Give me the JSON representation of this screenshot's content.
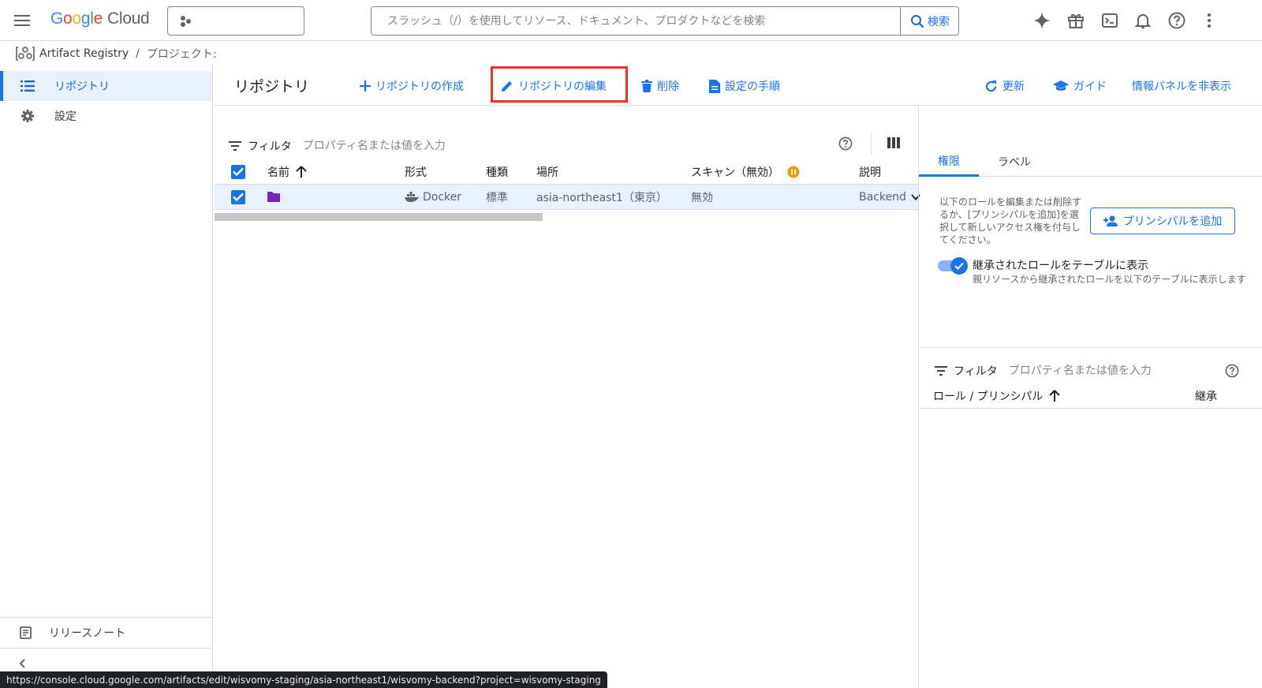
{
  "topbar": {
    "logo_letters": [
      "G",
      "o",
      "o",
      "g",
      "l",
      "e"
    ],
    "logo_product": "Cloud",
    "search_placeholder": "スラッシュ（/）を使用してリソース、ドキュメント、プロダクトなどを検索",
    "search_button": "検索"
  },
  "breadcrumb": {
    "service": "Artifact Registry",
    "separator": "/",
    "project_label": "プロジェクト:"
  },
  "sidebar": {
    "items": [
      {
        "label": "リポジトリ",
        "icon": "list-icon",
        "active": true
      },
      {
        "label": "設定",
        "icon": "gear-icon",
        "active": false
      }
    ],
    "release_notes": "リリースノート"
  },
  "toolbar": {
    "title": "リポジトリ",
    "create": "リポジトリの作成",
    "edit": "リポジトリの編集",
    "delete": "削除",
    "setup": "設定の手順",
    "refresh": "更新",
    "guide": "ガイド",
    "hide_panel": "情報パネルを非表示"
  },
  "filter": {
    "label": "フィルタ",
    "placeholder": "プロパティ名または値を入力"
  },
  "table": {
    "columns": [
      "名前",
      "形式",
      "種類",
      "場所",
      "スキャン（無効）",
      "説明"
    ],
    "rows": [
      {
        "name": "",
        "format": "Docker",
        "mode": "標準",
        "location": "asia-northeast1（東京）",
        "scan": "無効",
        "description": "Backend"
      }
    ]
  },
  "right_panel": {
    "tabs": [
      "権限",
      "ラベル"
    ],
    "description": "以下のロールを編集または削除するか、[プリンシパルを追加]を選択して新しいアクセス権を付与してください。",
    "add_principal": "プリンシパルを追加",
    "toggle_label": "継承されたロールをテーブルに表示",
    "toggle_sub": "親リソースから継承されたロールを以下のテーブルに表示します",
    "filter_label": "フィルタ",
    "filter_placeholder": "プロパティ名または値を入力",
    "columns": [
      "ロール / プリンシパル",
      "継承"
    ]
  },
  "status_url": "https://console.cloud.google.com/artifacts/edit/wisvomy-staging/asia-northeast1/wisvomy-backend?project=wisvomy-staging",
  "colors": {
    "accent": "#1a73e8",
    "highlight": "#ea3323",
    "selected_row": "#e8f0fe",
    "folder": "#7627bb",
    "scan_status": "#f29900"
  }
}
